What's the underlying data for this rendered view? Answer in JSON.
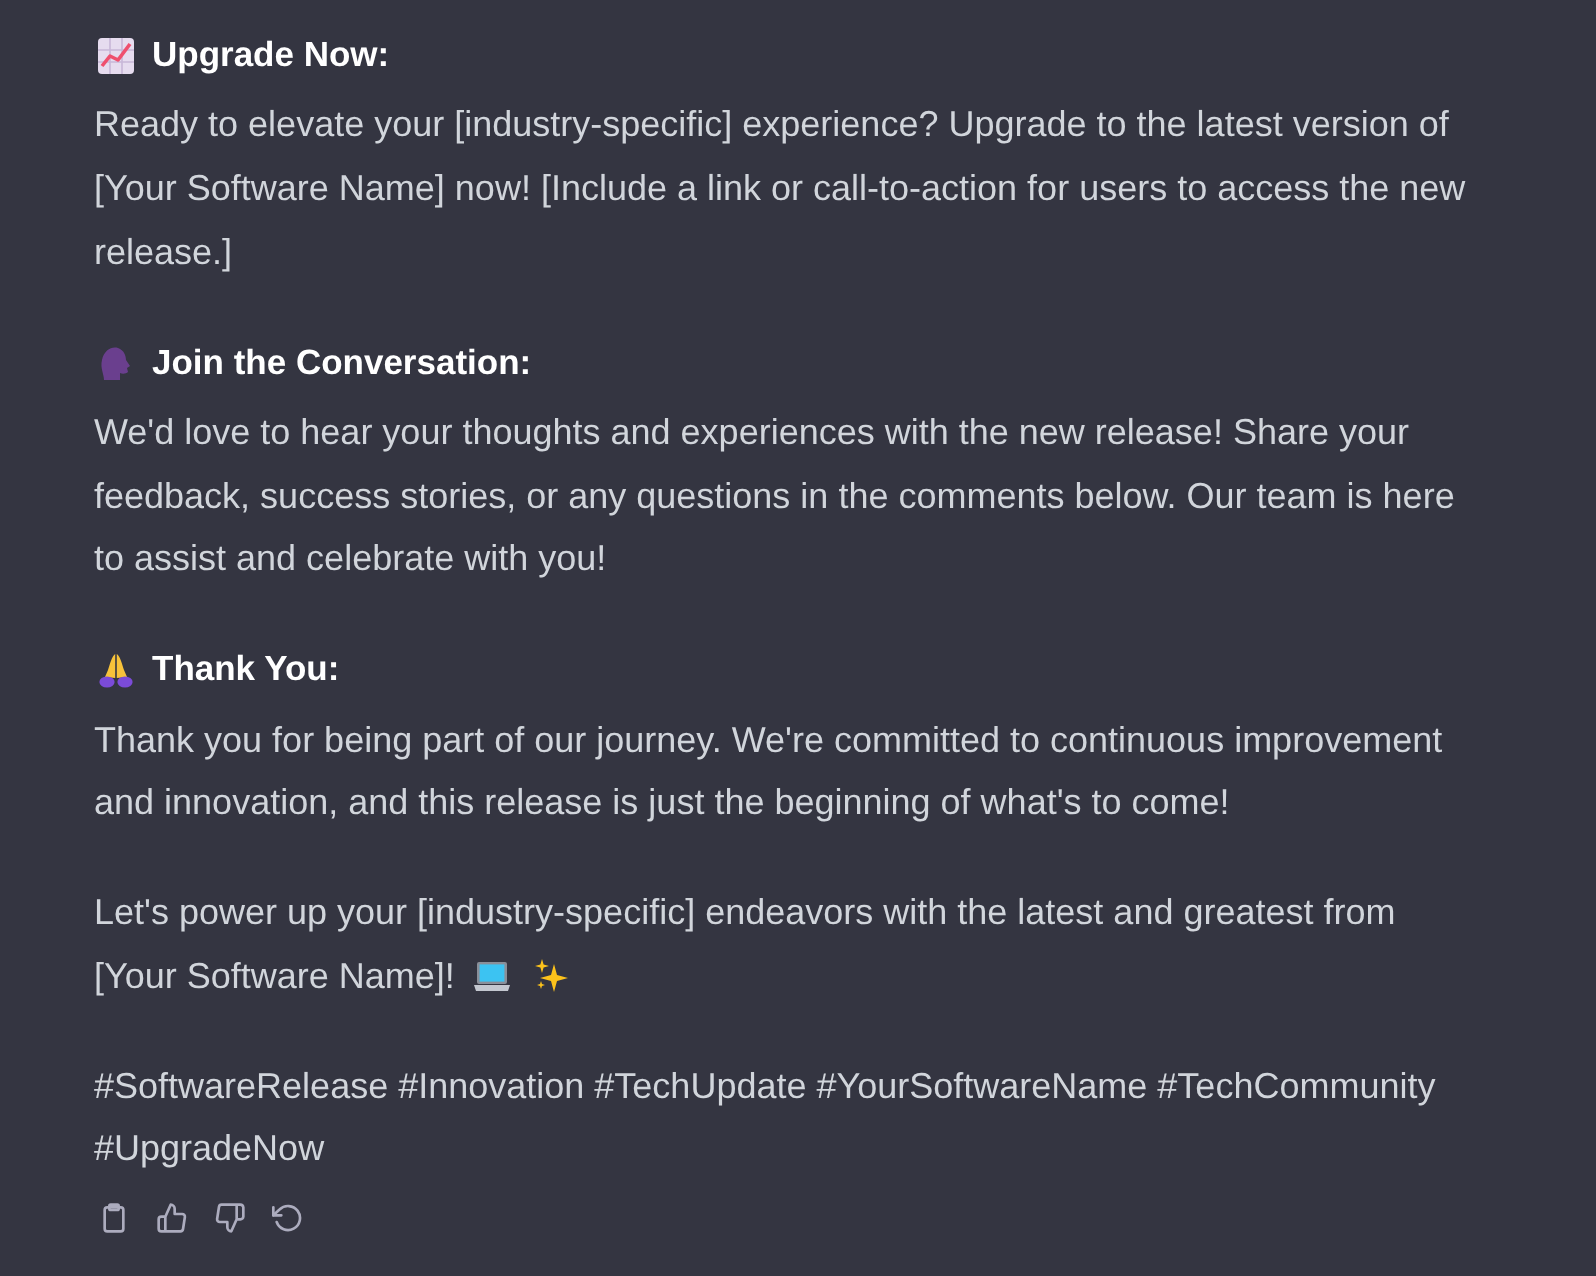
{
  "sections": [
    {
      "heading": "Upgrade Now:",
      "body": "Ready to elevate your [industry-specific] experience? Upgrade to the latest version of [Your Software Name] now! [Include a link or call-to-action for users to access the new release.]"
    },
    {
      "heading": "Join the Conversation:",
      "body": "We'd love to hear your thoughts and experiences with the new release! Share your feedback, success stories, or any questions in the comments below. Our team is here to assist and celebrate with you!"
    },
    {
      "heading": "Thank You:",
      "body": "Thank you for being part of our journey. We're committed to continuous improvement and innovation, and this release is just the beginning of what's to come!"
    }
  ],
  "closing": {
    "text": "Let's power up your [industry-specific] endeavors with the latest and greatest from [Your Software Name]!"
  },
  "hashtags": "#SoftwareRelease #Innovation #TechUpdate #YourSoftwareName #TechCommunity #UpgradeNow"
}
